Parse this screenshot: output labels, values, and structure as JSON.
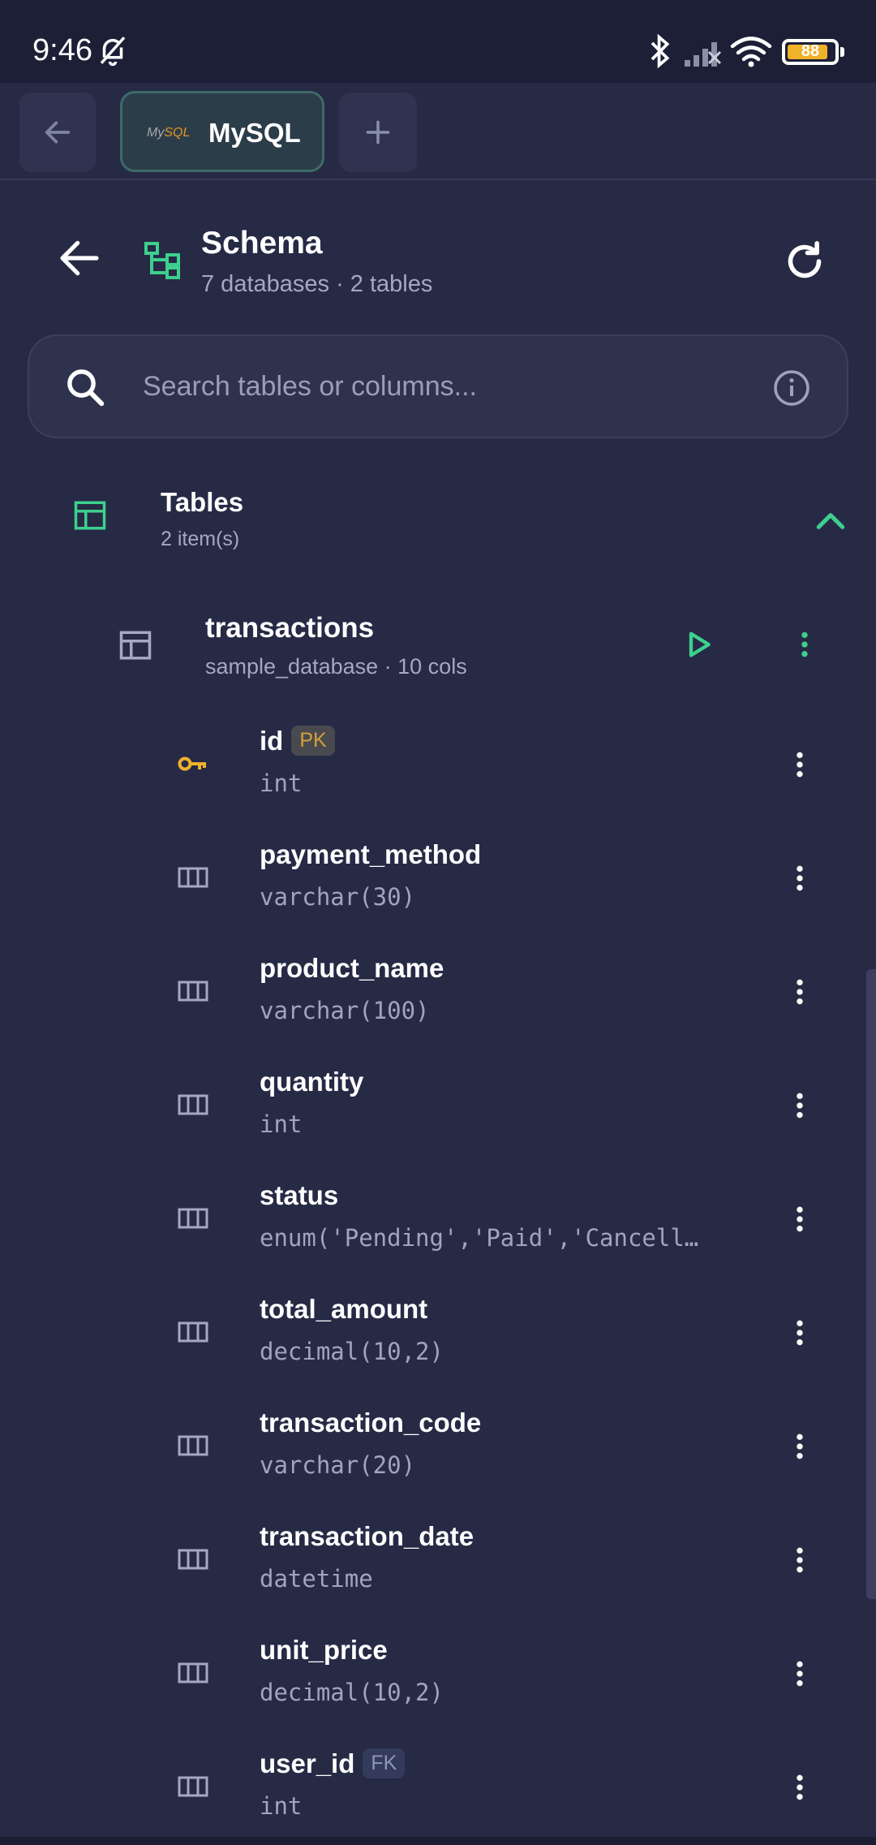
{
  "status_bar": {
    "time": "9:46",
    "battery": "88"
  },
  "colors": {
    "accent": "#3ecf8e",
    "pk": "#f0b12b",
    "background": "#262a45"
  },
  "tabs": {
    "connection_label": "MySQL",
    "logo_text_a": "My",
    "logo_text_b": "SQL"
  },
  "header": {
    "title": "Schema",
    "subtitle": "7 databases · 2 tables"
  },
  "search": {
    "placeholder": "Search tables or columns..."
  },
  "group": {
    "title": "Tables",
    "count": "2 item(s)"
  },
  "table": {
    "name": "transactions",
    "meta": "sample_database · 10 cols"
  },
  "columns": [
    {
      "name": "id",
      "type": "int",
      "badge": "PK"
    },
    {
      "name": "payment_method",
      "type": "varchar(30)",
      "badge": ""
    },
    {
      "name": "product_name",
      "type": "varchar(100)",
      "badge": ""
    },
    {
      "name": "quantity",
      "type": "int",
      "badge": ""
    },
    {
      "name": "status",
      "type": "enum('Pending','Paid','Cancell…",
      "badge": ""
    },
    {
      "name": "total_amount",
      "type": "decimal(10,2)",
      "badge": ""
    },
    {
      "name": "transaction_code",
      "type": "varchar(20)",
      "badge": ""
    },
    {
      "name": "transaction_date",
      "type": "datetime",
      "badge": ""
    },
    {
      "name": "unit_price",
      "type": "decimal(10,2)",
      "badge": ""
    },
    {
      "name": "user_id",
      "type": "int",
      "badge": "FK"
    }
  ]
}
